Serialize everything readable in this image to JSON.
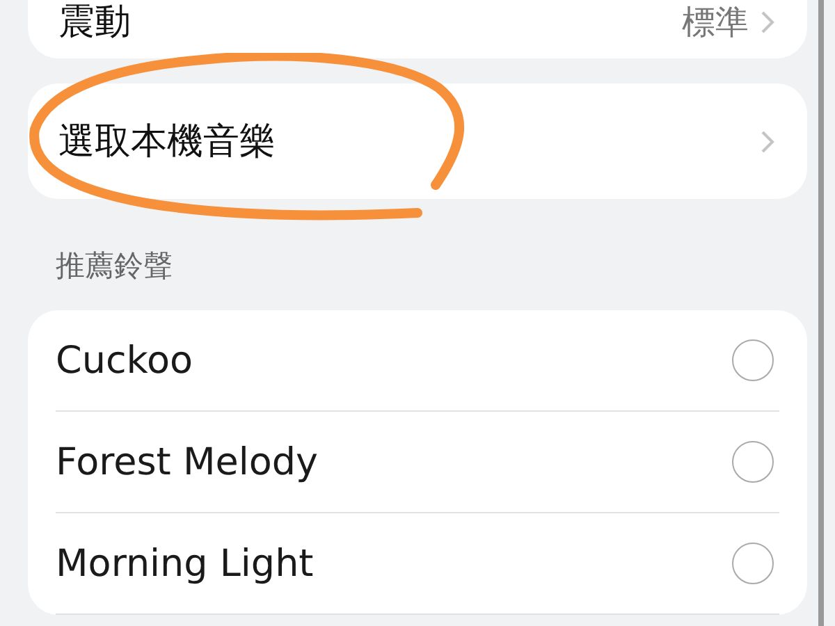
{
  "vibration": {
    "label": "震動",
    "value": "標準"
  },
  "local_music": {
    "label": "選取本機音樂"
  },
  "section_header": "推薦鈴聲",
  "ringtones": [
    {
      "name": "Cuckoo",
      "selected": false
    },
    {
      "name": "Forest Melody",
      "selected": false
    },
    {
      "name": "Morning Light",
      "selected": false
    }
  ]
}
